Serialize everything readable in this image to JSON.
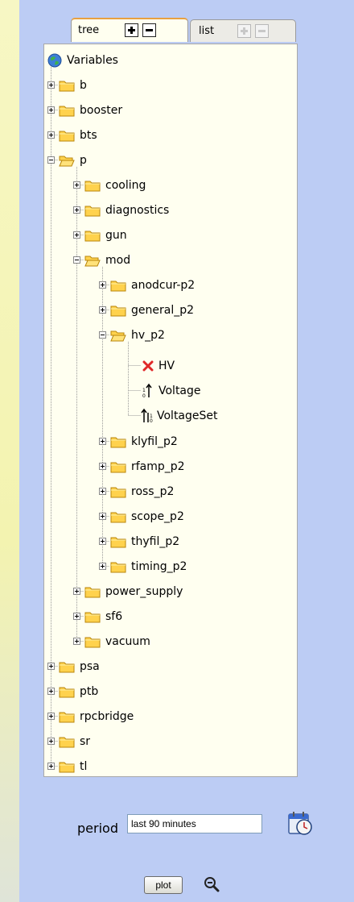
{
  "tabs": {
    "tree_label": "tree",
    "list_label": "list"
  },
  "tree": {
    "root_label": "Variables",
    "nodes": {
      "b": "b",
      "booster": "booster",
      "bts": "bts",
      "p": "p",
      "cooling": "cooling",
      "diagnostics": "diagnostics",
      "gun": "gun",
      "mod": "mod",
      "anodcur_p2": "anodcur-p2",
      "general_p2": "general_p2",
      "hv_p2": "hv_p2",
      "hv": "HV",
      "voltage": "Voltage",
      "voltageset": "VoltageSet",
      "klyfil_p2": "klyfil_p2",
      "rfamp_p2": "rfamp_p2",
      "ross_p2": "ross_p2",
      "scope_p2": "scope_p2",
      "thyfil_p2": "thyfil_p2",
      "timing_p2": "timing_p2",
      "power_supply": "power_supply",
      "sf6": "sf6",
      "vacuum": "vacuum",
      "psa": "psa",
      "ptb": "ptb",
      "rpcbridge": "rpcbridge",
      "sr": "sr",
      "tl": "tl"
    }
  },
  "controls": {
    "period_label": "period",
    "period_value": "last 90 minutes",
    "plot_label": "plot"
  },
  "icons": {
    "globe": "globe-icon",
    "folder_closed": "folder-icon",
    "folder_open": "folder-open-icon",
    "error": "error-x-icon",
    "signal": "signal-icon",
    "calendar": "calendar-icon",
    "zoom": "zoom-out-icon"
  },
  "colors": {
    "background": "#bcccf4",
    "panel": "#fffff0",
    "folder": "#ffd24d",
    "error": "#e02828"
  }
}
